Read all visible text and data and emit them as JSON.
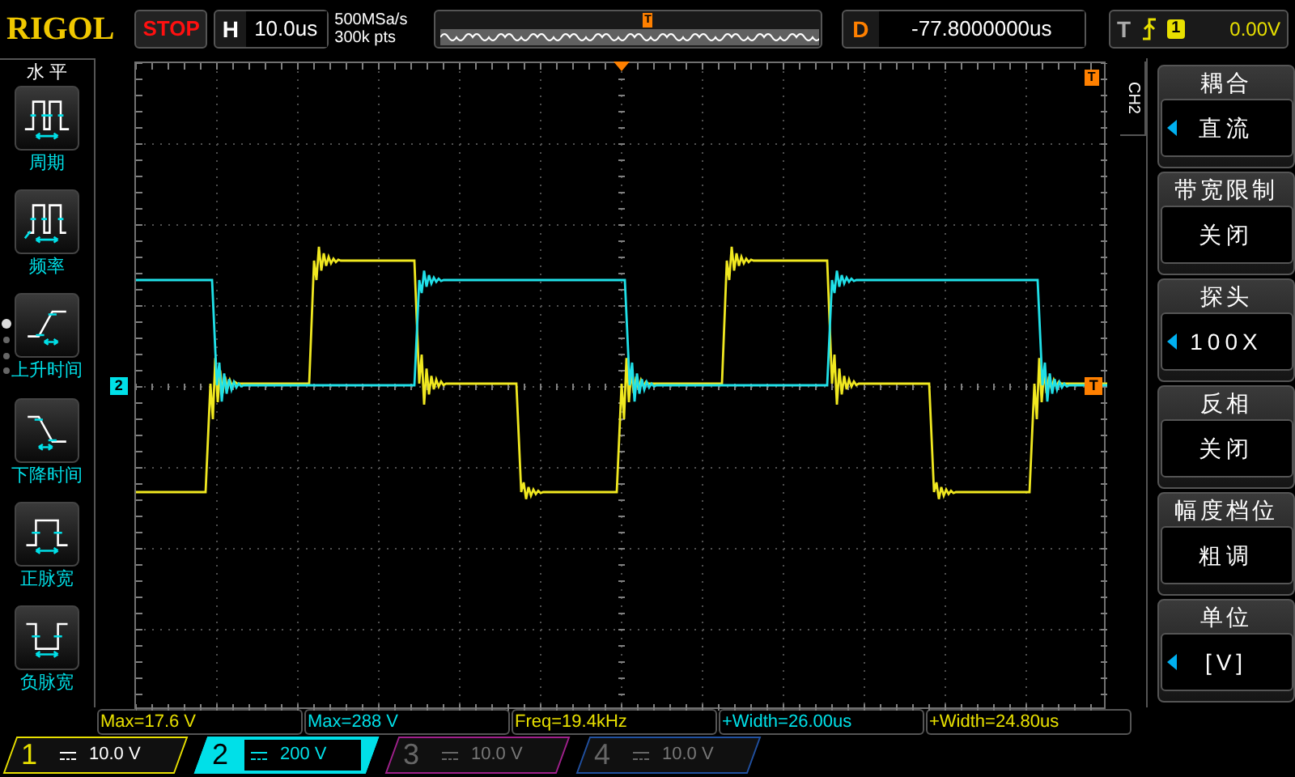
{
  "brand": "RIGOL",
  "run_state": "STOP",
  "horizontal": {
    "label": "H",
    "timebase": "10.0us"
  },
  "sample_rate": "500MSa/s",
  "memory_depth": "300k pts",
  "overview_marker": "T",
  "delay": {
    "label": "D",
    "value": "-77.8000000us"
  },
  "trigger": {
    "label": "T",
    "source": "1",
    "level": "0.00V"
  },
  "left_menu": {
    "title": "水 平",
    "items": [
      {
        "label": "周期",
        "kind": "period"
      },
      {
        "label": "频率",
        "kind": "frequency"
      },
      {
        "label": "上升时间",
        "kind": "rise"
      },
      {
        "label": "下降时间",
        "kind": "fall"
      },
      {
        "label": "正脉宽",
        "kind": "pos_width"
      },
      {
        "label": "负脉宽",
        "kind": "neg_width"
      }
    ]
  },
  "plot": {
    "channel_marker": "2",
    "trigger_marker": "T",
    "top_trigger_marker": "T"
  },
  "right_menu": {
    "channel": "CH2",
    "items": [
      {
        "title": "耦合",
        "value": "直流",
        "adjustable": true
      },
      {
        "title": "带宽限制",
        "value": "关闭",
        "adjustable": false
      },
      {
        "title": "探头",
        "value": "100X",
        "adjustable": true
      },
      {
        "title": "反相",
        "value": "关闭",
        "adjustable": false
      },
      {
        "title": "幅度档位",
        "value": "粗调",
        "adjustable": false
      },
      {
        "title": "单位",
        "value": "[V]",
        "adjustable": true
      }
    ]
  },
  "measurements": [
    {
      "text": "Max=17.6 V",
      "color": "#e8e000"
    },
    {
      "text": "Max=288 V",
      "color": "#00e0e8"
    },
    {
      "text": "Freq=19.4kHz",
      "color": "#e8e000"
    },
    {
      "text": "+Width=26.00us",
      "color": "#00e0e8"
    },
    {
      "text": "+Width=24.80us",
      "color": "#e8e000"
    }
  ],
  "channels": [
    {
      "number": "1",
      "scale": "10.0 V",
      "on": true,
      "selected": false,
      "color": "#e8e000"
    },
    {
      "number": "2",
      "scale": "200 V",
      "on": true,
      "selected": true,
      "color": "#00e0e8"
    },
    {
      "number": "3",
      "scale": "10.0 V",
      "on": false,
      "selected": false,
      "color": "#a0208c"
    },
    {
      "number": "4",
      "scale": "10.0 V",
      "on": false,
      "selected": false,
      "color": "#2050a0"
    }
  ]
}
